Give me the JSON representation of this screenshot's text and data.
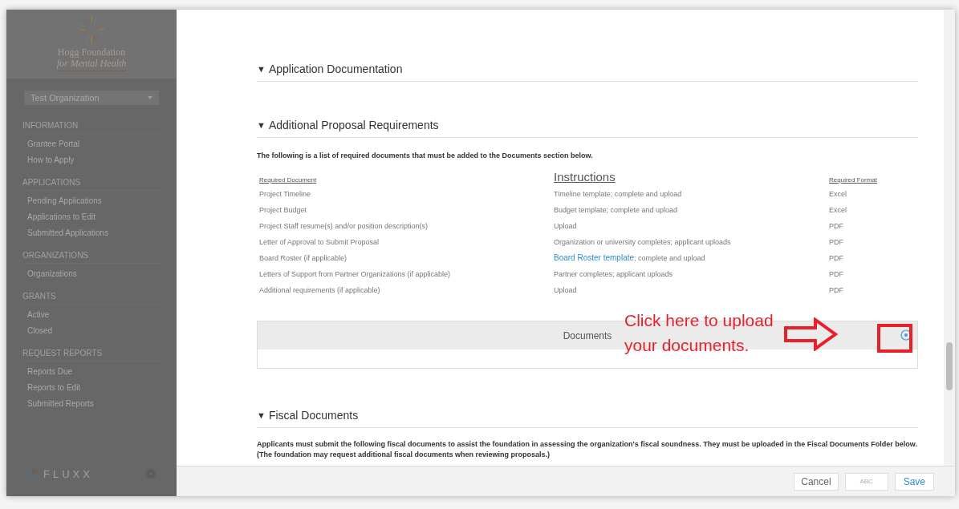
{
  "sidebar": {
    "logo_line1": "Hogg Foundation",
    "logo_line2": "for Mental Health",
    "organization": "Test Organization",
    "groups": [
      {
        "title": "INFORMATION",
        "items": [
          "Grantee Portal",
          "How to Apply"
        ]
      },
      {
        "title": "APPLICATIONS",
        "items": [
          "Pending Applications",
          "Applications to Edit",
          "Submitted Applications"
        ]
      },
      {
        "title": "ORGANIZATIONS",
        "items": [
          "Organizations"
        ]
      },
      {
        "title": "GRANTS",
        "items": [
          "Active",
          "Closed"
        ]
      },
      {
        "title": "REQUEST REPORTS",
        "items": [
          "Reports Due",
          "Reports to Edit",
          "Submitted Reports"
        ]
      }
    ],
    "brand": "FLUXX"
  },
  "sections": [
    {
      "marker": "▼",
      "title": "Application Documentation",
      "expanded": true
    },
    {
      "marker": "▼",
      "title": "Additional Proposal Requirements",
      "expanded": true
    }
  ],
  "intro": "The following is a list of required documents that must be added to the Documents section below.",
  "table": {
    "columns": [
      "Required Document",
      "Instructions",
      "Required Format"
    ],
    "rows": [
      {
        "document": "Project Timeline",
        "instruction": "Timeline template; complete and upload",
        "format": "Excel"
      },
      {
        "document": "Project Budget",
        "instruction": "Budget template; complete and upload",
        "format": "Excel"
      },
      {
        "document": "Project Staff resume(s) and/or position description(s)",
        "instruction": "Upload",
        "format": "PDF"
      },
      {
        "document": "Letter of Approval to Submit Proposal",
        "instruction": "Organization or university completes; applicant uploads",
        "format": "PDF"
      },
      {
        "document": "Board Roster (if applicable)",
        "instruction_link": "Board Roster template",
        "instruction": "; complete and upload",
        "format": "PDF"
      },
      {
        "document": "Letters of Support from Partner Organizations (if applicable)",
        "instruction": "Partner completes; applicant uploads",
        "format": "PDF"
      },
      {
        "document": "Additional requirements (if applicable)",
        "instruction": "Upload",
        "format": "PDF"
      }
    ]
  },
  "documents_panel": {
    "title": "Documents"
  },
  "annotation": {
    "line1": "Click here to upload",
    "line2": "your documents."
  },
  "fiscal": {
    "marker": "▼",
    "title": "Fiscal Documents",
    "expanded": true,
    "text": "Applicants must submit the following fiscal documents to assist the foundation in assessing the organization's fiscal soundness.  They must be uploaded in the Fiscal Documents Folder below.  (The foundation may request additional fiscal documents when reviewing proposals.)"
  },
  "footer": {
    "cancel": "Cancel",
    "spell": "ABC",
    "save": "Save"
  }
}
